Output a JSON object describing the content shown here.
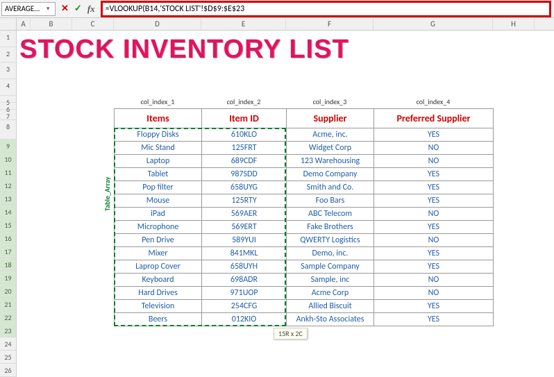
{
  "name_box": "AVERAGE...",
  "formula": "=VLOOKUP(B14,'STOCK LIST'!$D$9:$E$23",
  "title": "STOCK INVENTORY LIST",
  "col_headers": [
    "A",
    "B",
    "C",
    "D",
    "E",
    "F",
    "G",
    "H"
  ],
  "row_headers": [
    "1",
    "2",
    "3",
    "4",
    "5",
    "6",
    "7",
    "8",
    "9",
    "10",
    "11",
    "12",
    "13",
    "14",
    "15",
    "16",
    "17",
    "18",
    "19",
    "20",
    "21",
    "22",
    "23",
    "24",
    "25",
    "26"
  ],
  "col_index_labels": [
    "col_index_1",
    "col_index_2",
    "col_index_3",
    "col_index_4"
  ],
  "table_array_label": "Table_Array",
  "table_headers": [
    "Items",
    "Item ID",
    "Supplier",
    "Preferred Supplier"
  ],
  "rows": [
    {
      "item": "Floppy Disks",
      "id": "610KLO",
      "supplier": "Acme, inc.",
      "pref": "YES"
    },
    {
      "item": "Mic Stand",
      "id": "125FRT",
      "supplier": "Widget Corp",
      "pref": "NO"
    },
    {
      "item": "Laptop",
      "id": "689CDF",
      "supplier": "123 Warehousing",
      "pref": "NO"
    },
    {
      "item": "Tablet",
      "id": "987SDD",
      "supplier": "Demo Company",
      "pref": "YES"
    },
    {
      "item": "Pop filter",
      "id": "658UYG",
      "supplier": "Smith and Co.",
      "pref": "YES"
    },
    {
      "item": "Mouse",
      "id": "125RTY",
      "supplier": "Foo Bars",
      "pref": "YES"
    },
    {
      "item": "iPad",
      "id": "569AER",
      "supplier": "ABC Telecom",
      "pref": "NO"
    },
    {
      "item": "Microphone",
      "id": "569ERT",
      "supplier": "Fake Brothers",
      "pref": "YES"
    },
    {
      "item": "Pen Drive",
      "id": "589YUI",
      "supplier": "QWERTY Logistics",
      "pref": "NO"
    },
    {
      "item": "Mixer",
      "id": "841MKL",
      "supplier": "Demo, inc.",
      "pref": "YES"
    },
    {
      "item": "Laprop Cover",
      "id": "658UYH",
      "supplier": "Sample Company",
      "pref": "YES"
    },
    {
      "item": "Keyboard",
      "id": "698ADR",
      "supplier": "Sample, inc",
      "pref": "NO"
    },
    {
      "item": "Hard Drives",
      "id": "971UOP",
      "supplier": "Acme Corp",
      "pref": "NO"
    },
    {
      "item": "Television",
      "id": "254CFG",
      "supplier": "Allied Biscuit",
      "pref": "YES"
    },
    {
      "item": "Beers",
      "id": "012KIO",
      "supplier": "Ankh-Sto Associates",
      "pref": "YES"
    }
  ],
  "selection_badge": "15R x 2C"
}
